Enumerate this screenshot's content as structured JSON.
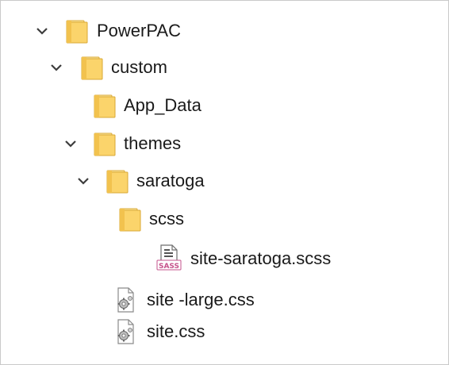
{
  "tree": {
    "items": [
      {
        "label": "PowerPAC",
        "icon": "folder-icon",
        "expanded": true
      },
      {
        "label": "custom",
        "icon": "folder-icon",
        "expanded": true
      },
      {
        "label": "App_Data",
        "icon": "folder-icon"
      },
      {
        "label": "themes",
        "icon": "folder-icon",
        "expanded": true
      },
      {
        "label": "saratoga",
        "icon": "folder-icon",
        "expanded": true
      },
      {
        "label": "scss",
        "icon": "folder-icon"
      },
      {
        "label": "site-saratoga.scss",
        "icon": "sass-file-icon"
      },
      {
        "label": "site -large.css",
        "icon": "css-file-icon"
      },
      {
        "label": "site.css",
        "icon": "css-file-icon"
      }
    ]
  },
  "colors": {
    "folder_fill": "#fbd46b",
    "folder_light": "#fde8a2",
    "folder_edge": "#d9a834",
    "sass_pink": "#c6538c",
    "chevron": "#3d3d3d",
    "border": "#c9c9c9"
  }
}
